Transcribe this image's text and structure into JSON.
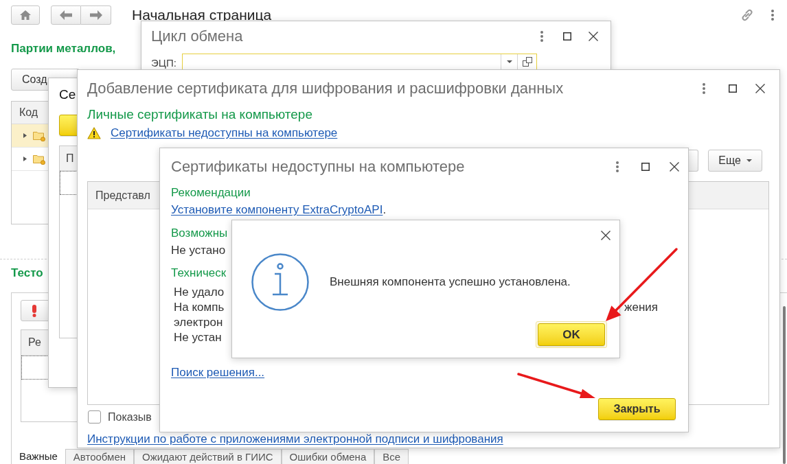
{
  "page": {
    "title": "Начальная страница",
    "metal_batches": {
      "heading": "Партии металлов,",
      "create_button": "Созд",
      "table": {
        "columns": [
          "Код"
        ],
        "rows": [
          {
            "selected": true,
            "expanded": false
          },
          {
            "selected": false,
            "expanded": false
          }
        ]
      }
    },
    "tests": {
      "heading": "Тесто",
      "table": {
        "columns": [
          "Ре"
        ]
      }
    },
    "tabs": [
      {
        "label": "Важные",
        "selected": true
      },
      {
        "label": "Автообмен",
        "selected": false
      },
      {
        "label": "Ожидают действий в ГИИС",
        "selected": false
      },
      {
        "label": "Ошибки обмена",
        "selected": false
      },
      {
        "label": "Все",
        "selected": false
      }
    ]
  },
  "exchange_window": {
    "title": "Цикл обмена",
    "signature_field": {
      "label": "ЭЦП:"
    }
  },
  "certificate_window": {
    "title": "Се",
    "table": {
      "columns": [
        "П"
      ]
    }
  },
  "add_certificate_window": {
    "title": "Добавление сертификата для шифрования и расшифровки данных",
    "heading": "Личные сертификаты на компьютере",
    "warning_link": "Сертификаты недоступны на компьютере",
    "more_button": "Еще",
    "table": {
      "columns": [
        "Представл"
      ]
    },
    "show_checkbox": {
      "label": "Показыв",
      "checked": false
    },
    "instructions_link": "Инструкции по работе с приложениями электронной подписи и шифрования"
  },
  "unavailable_window": {
    "title": "Сертификаты недоступны на компьютере",
    "sections": [
      {
        "kind": "link",
        "heading": "Рекомендации",
        "link": "Установите компоненту ExtraCryptoAPI",
        "suffix": "."
      },
      {
        "kind": "text",
        "heading": "Возможны",
        "lines": [
          {
            "left": "Не устано"
          }
        ]
      },
      {
        "kind": "details",
        "heading": "Техническ",
        "lines": [
          {
            "left": "Не удало"
          },
          {
            "left": "На компь",
            "right": "жения"
          },
          {
            "left": "электрон"
          },
          {
            "left": "Не устан"
          }
        ]
      }
    ],
    "search_link": "Поиск решения...",
    "close_button": "Закрыть"
  },
  "message_box": {
    "text": "Внешняя компонента успешно установлена.",
    "ok_button": "OK"
  }
}
